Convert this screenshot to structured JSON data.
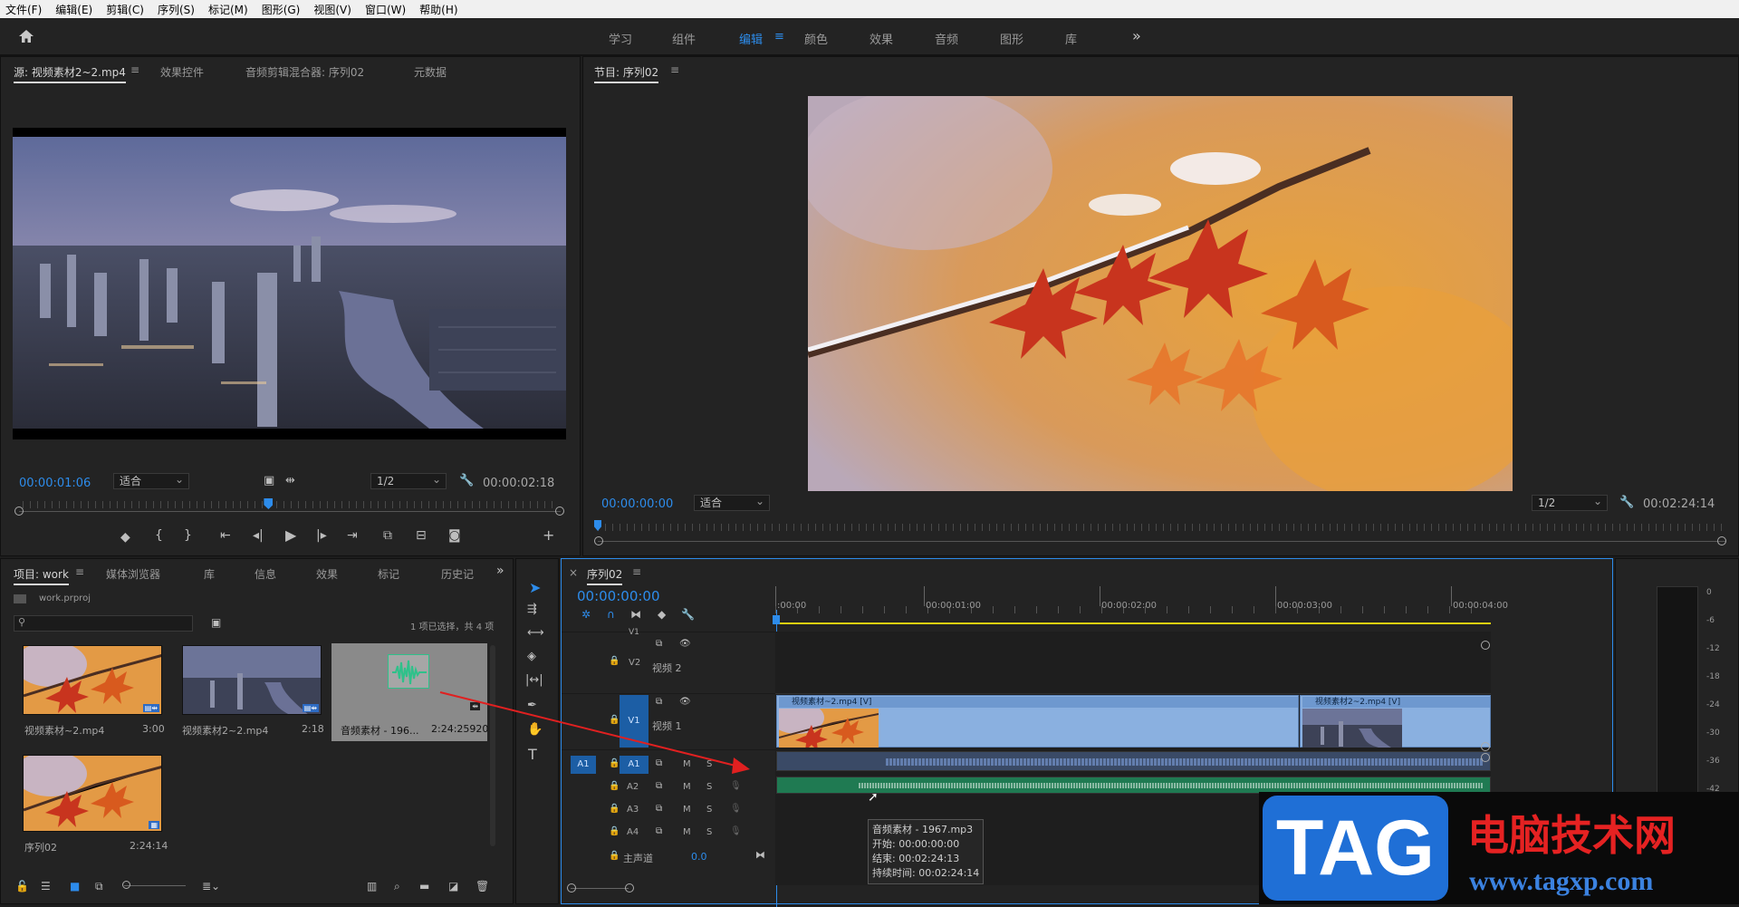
{
  "menu": [
    "文件(F)",
    "编辑(E)",
    "剪辑(C)",
    "序列(S)",
    "标记(M)",
    "图形(G)",
    "视图(V)",
    "窗口(W)",
    "帮助(H)"
  ],
  "workspaces": [
    {
      "label": "学习",
      "active": false
    },
    {
      "label": "组件",
      "active": false
    },
    {
      "label": "编辑",
      "active": true
    },
    {
      "label": "颜色",
      "active": false
    },
    {
      "label": "效果",
      "active": false
    },
    {
      "label": "音频",
      "active": false
    },
    {
      "label": "图形",
      "active": false
    },
    {
      "label": "库",
      "active": false
    }
  ],
  "source_panel": {
    "tabs": [
      "源: 视频素材2~2.mp4",
      "效果控件",
      "音频剪辑混合器: 序列02",
      "元数据"
    ],
    "timecode_current": "00:00:01:06",
    "fit": "适合",
    "resolution": "1/2",
    "timecode_duration": "00:00:02:18",
    "playhead_fraction": 0.46
  },
  "program_panel": {
    "title": "节目: 序列02",
    "timecode_current": "00:00:00:00",
    "fit": "适合",
    "resolution": "1/2",
    "timecode_duration": "00:02:24:14",
    "playhead_fraction": 0.0
  },
  "project_panel": {
    "tabs": [
      "项目: work",
      "媒体浏览器",
      "库",
      "信息",
      "效果",
      "标记",
      "历史记"
    ],
    "project_file": "work.prproj",
    "selection_status": "1 项已选择，共 4 项",
    "items": [
      {
        "name": "视频素材~2.mp4",
        "duration": "3:00",
        "kind": "video-leaf"
      },
      {
        "name": "视频素材2~2.mp4",
        "duration": "2:18",
        "kind": "video-city"
      },
      {
        "name": "音频素材 - 196...",
        "duration": "2:24:25920",
        "kind": "audio"
      },
      {
        "name": "序列02",
        "duration": "2:24:14",
        "kind": "sequence"
      }
    ]
  },
  "timeline": {
    "sequence_tab": "序列02",
    "timecode": "00:00:00:00",
    "ruler": [
      ":00:00",
      "00:00:01:00",
      "00:00:02:00",
      "00:00:03:00",
      "00:00:04:00"
    ],
    "tracks": {
      "v1_label": "V1",
      "v2_label": "V2",
      "v2_name": "视频 2",
      "v1_name": "视频 1",
      "a1": "A1",
      "a2": "A2",
      "a3": "A3",
      "a4": "A4",
      "master_name": "主声道",
      "master_value": "0.0",
      "m": "M",
      "s": "S"
    },
    "clips": [
      "视频素材~2.mp4 [V]",
      "视频素材2~2.mp4 [V]"
    ],
    "tooltip": [
      "音频素材 - 1967.mp3",
      "开始: 00:00:00:00",
      "结束: 00:02:24:13",
      "持续时间: 00:02:24:14"
    ]
  },
  "meter_scale": [
    "0",
    "-6",
    "-12",
    "-18",
    "-24",
    "-30",
    "-36",
    "-42"
  ],
  "watermark": {
    "badge": "TAG",
    "title": "电脑技术网",
    "url": "www.tagxp.com"
  }
}
